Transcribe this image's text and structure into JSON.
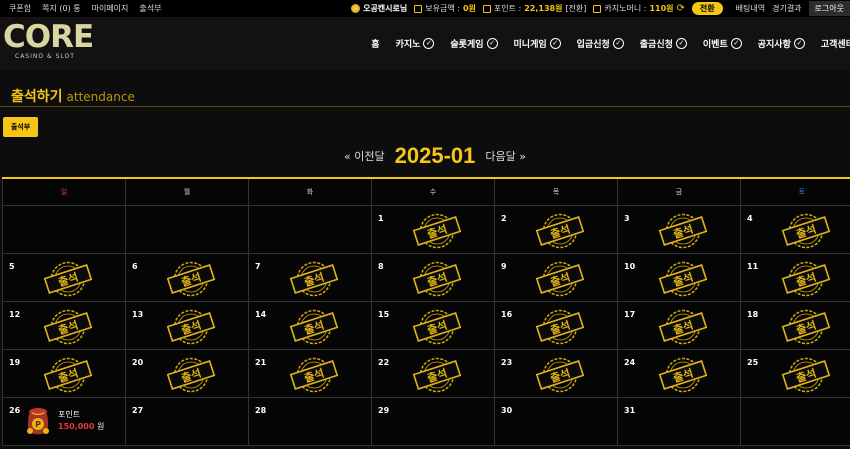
{
  "topbar": {
    "left_links": [
      "쿠폰함",
      "쪽지 (0) 통",
      "마이페이지",
      "출석부"
    ],
    "user_name": "오공캔시로님",
    "balance_label": "보유금액 : ",
    "balance_value": "0원",
    "point_label": "포인트 : ",
    "point_value": "22,138원",
    "point_convert": "[전환]",
    "casino_money_label": "카지노머니 : ",
    "casino_money_value": "110원",
    "convert_btn": "전환",
    "bet_history": "배팅내역",
    "results": "경기결과",
    "logout": "로그아웃"
  },
  "logo": {
    "main": "CORE",
    "sub": "CASINO & SLOT"
  },
  "nav": {
    "items": [
      "홈",
      "카지노",
      "슬롯게임",
      "미니게임",
      "입금신청",
      "출금신청",
      "이벤트",
      "공지사항",
      "고객센터"
    ]
  },
  "page": {
    "title": "출석하기",
    "subtitle": "attendance",
    "tag": "출석부"
  },
  "calendar": {
    "prev": "« 이전달",
    "month": "2025-01",
    "next": "다음달 »",
    "weekdays": [
      "일",
      "월",
      "화",
      "수",
      "목",
      "금",
      "토"
    ],
    "stamp_label": "출석",
    "rows": [
      [
        "",
        "",
        "",
        "1",
        "2",
        "3",
        "4"
      ],
      [
        "5",
        "6",
        "7",
        "8",
        "9",
        "10",
        "11"
      ],
      [
        "12",
        "13",
        "14",
        "15",
        "16",
        "17",
        "18"
      ],
      [
        "19",
        "20",
        "21",
        "22",
        "23",
        "24",
        "25"
      ],
      [
        "26",
        "27",
        "28",
        "29",
        "30",
        "31",
        ""
      ]
    ],
    "attended": [
      1,
      2,
      3,
      4,
      5,
      6,
      7,
      8,
      9,
      10,
      11,
      12,
      13,
      14,
      15,
      16,
      17,
      18,
      19,
      20,
      21,
      22,
      23,
      24,
      25
    ],
    "reward": {
      "day": "26",
      "label": "포인트",
      "amount": "150,000",
      "unit": "원"
    }
  },
  "colors": {
    "accent": "#f5c518",
    "sunday": "#e03b3b",
    "saturday": "#3b7de0"
  }
}
